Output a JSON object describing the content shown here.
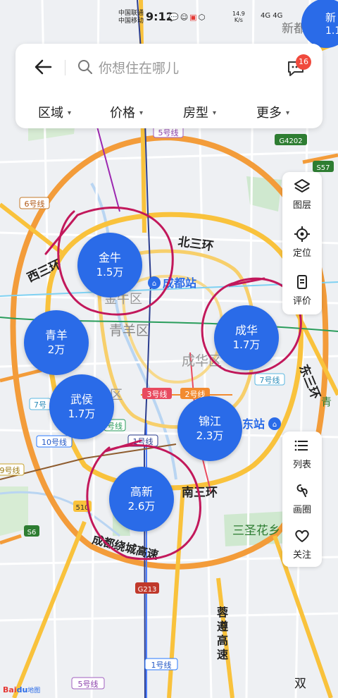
{
  "status_bar": {
    "carrier1": "中国联通",
    "carrier2": "中国移动",
    "time": "9:12",
    "net_speed": "14.9",
    "net_unit": "K/s",
    "signal": "4G 4G"
  },
  "search": {
    "placeholder": "你想住在哪儿",
    "message_badge": "16"
  },
  "filters": [
    "区域",
    "价格",
    "房型",
    "更多"
  ],
  "side_tools_top": [
    {
      "label": "图层",
      "icon": "layers-icon"
    },
    {
      "label": "定位",
      "icon": "locate-icon"
    },
    {
      "label": "评价",
      "icon": "review-icon"
    }
  ],
  "side_tools_bottom": [
    {
      "label": "列表",
      "icon": "list-icon"
    },
    {
      "label": "画圈",
      "icon": "draw-circle-icon"
    },
    {
      "label": "关注",
      "icon": "heart-icon"
    }
  ],
  "district_bubbles": [
    {
      "name": "金牛",
      "price": "1.5万"
    },
    {
      "name": "青羊",
      "price": "2万"
    },
    {
      "name": "成华",
      "price": "1.7万"
    },
    {
      "name": "武侯",
      "price": "1.7万"
    },
    {
      "name": "锦江",
      "price": "2.3万"
    },
    {
      "name": "高新",
      "price": "2.6万"
    }
  ],
  "partial_bubble": {
    "name": "新",
    "price": "1.1"
  },
  "map_labels": {
    "north_ring": "北三环",
    "west_ring": "西三环",
    "east_ring": "东三环",
    "south_ring": "南三环",
    "chengdu_station": "成都站",
    "east_station": "东站",
    "qingyang_district": "青羊区",
    "chenghua_district": "成华区",
    "jinniu_district": "金牛区",
    "wuhou_district": "武区",
    "ring_expressway": "成都绕城高速",
    "sanshenghua": "三圣花乡",
    "puzun": "蓉遵高速",
    "shuang": "双",
    "qing": "青",
    "xindu": "新都"
  },
  "metro_labels": {
    "l5_top": "5号线",
    "l6": "6号线",
    "l3": "3号线",
    "l2": "2号线",
    "l7a": "7号线",
    "l7b": "7号",
    "l10": "10号线",
    "l1": "1号线",
    "l1b": "1号线",
    "l9": "9号线",
    "l5b": "5号线",
    "lxian": "号线"
  },
  "road_shields": {
    "g4202": "G4202",
    "s57": "S57",
    "s6": "S6",
    "g213": "G213",
    "m510": "510"
  },
  "logo": {
    "bai": "Bai",
    "du": "du",
    "ditu": "地图"
  },
  "colors": {
    "bubble": "#2a6be8",
    "annotation": "#c2185b",
    "badge": "#f04a3d",
    "metro_red": "#e84a5f",
    "metro_blue": "#2979ff",
    "metro_green": "#2a9d5c",
    "ring_road": "#f9c23c"
  }
}
